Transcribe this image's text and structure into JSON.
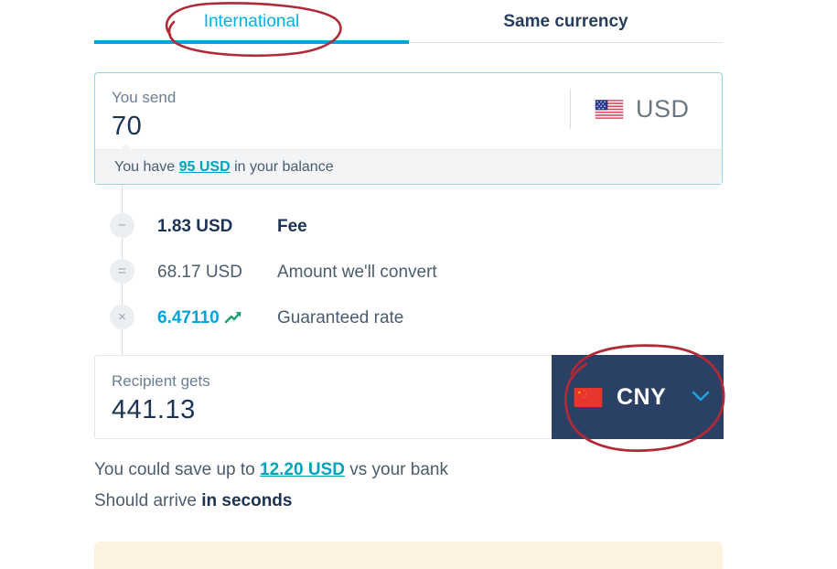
{
  "colors": {
    "accent_blue": "#00a3e0",
    "link_teal": "#00a3bd",
    "navy": "#1c3353",
    "cny_button_bg": "#2a4065",
    "annotation_red": "#b02a37",
    "banner_cream": "#fdf2df",
    "card_border_blue": "#90d7e8"
  },
  "tabs": [
    {
      "label": "International",
      "active": true,
      "name": "tab-international"
    },
    {
      "label": "Same currency",
      "active": false,
      "name": "tab-same-currency"
    }
  ],
  "send": {
    "label": "You send",
    "amount": "70",
    "currency_code": "USD",
    "flag_icon": "us-flag-icon",
    "balance_prefix": "You have ",
    "balance_link": "95 USD",
    "balance_suffix": " in your balance"
  },
  "breakdown": [
    {
      "operator": "−",
      "operator_icon": "minus-icon",
      "value": "1.83 USD",
      "description": "Fee",
      "style": "strong"
    },
    {
      "operator": "=",
      "operator_icon": "equals-icon",
      "value": "68.17 USD",
      "description": "Amount we'll convert",
      "style": "plain"
    },
    {
      "operator": "×",
      "operator_icon": "multiply-icon",
      "value": "6.47110",
      "description": "Guaranteed rate",
      "style": "rate",
      "trend_icon": "trend-up-icon"
    }
  ],
  "recipient": {
    "label": "Recipient gets",
    "amount": "441.13",
    "currency_code": "CNY",
    "flag_icon": "cn-flag-icon",
    "chevron_icon": "chevron-down-icon"
  },
  "notes": {
    "save_prefix": "You could save up to ",
    "save_link": "12.20 USD",
    "save_suffix": " vs your bank",
    "arrive_prefix": "Should arrive ",
    "arrive_strong": "in seconds"
  },
  "annotations": [
    {
      "name": "annotation-circle-international",
      "target": "International tab"
    },
    {
      "name": "annotation-circle-cny",
      "target": "CNY currency selector"
    }
  ]
}
